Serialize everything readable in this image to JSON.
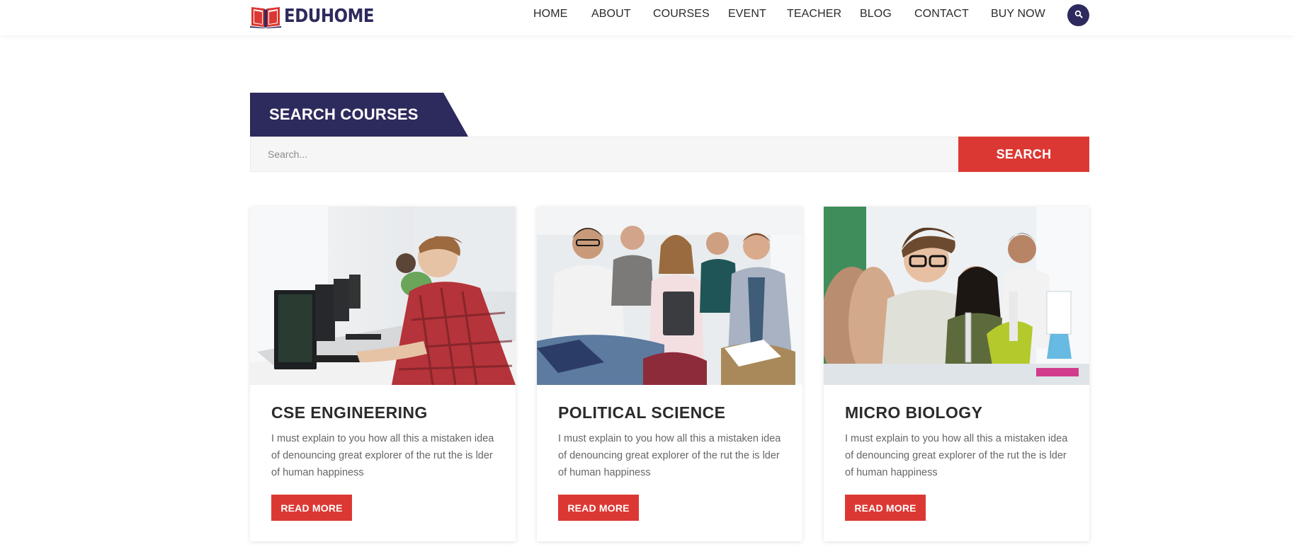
{
  "brand": {
    "name": "EDUHOME",
    "primary_color": "#2d2a5d",
    "accent_color": "#dc3833",
    "logo_icon": "open-book-icon"
  },
  "nav": {
    "items": [
      {
        "label": "HOME"
      },
      {
        "label": "ABOUT"
      },
      {
        "label": "COURSES"
      },
      {
        "label": "EVENT"
      },
      {
        "label": "TEACHER"
      },
      {
        "label": "BLOG"
      },
      {
        "label": "CONTACT"
      },
      {
        "label": "BUY NOW"
      }
    ],
    "search_icon": "search-icon"
  },
  "search": {
    "title": "SEARCH COURSES",
    "placeholder": "Search...",
    "button_label": "SEARCH"
  },
  "courses": [
    {
      "title": "CSE ENGINEERING",
      "description": "I must explain to you how all this a mistaken idea of denouncing great explorer of the rut the is lder of human happiness",
      "button_label": "READ MORE"
    },
    {
      "title": "POLITICAL SCIENCE",
      "description": "I must explain to you how all this a mistaken idea of denouncing great explorer of the rut the is lder of human happiness",
      "button_label": "READ MORE"
    },
    {
      "title": "MICRO BIOLOGY",
      "description": "I must explain to you how all this a mistaken idea of denouncing great explorer of the rut the is lder of human happiness",
      "button_label": "READ MORE"
    }
  ]
}
